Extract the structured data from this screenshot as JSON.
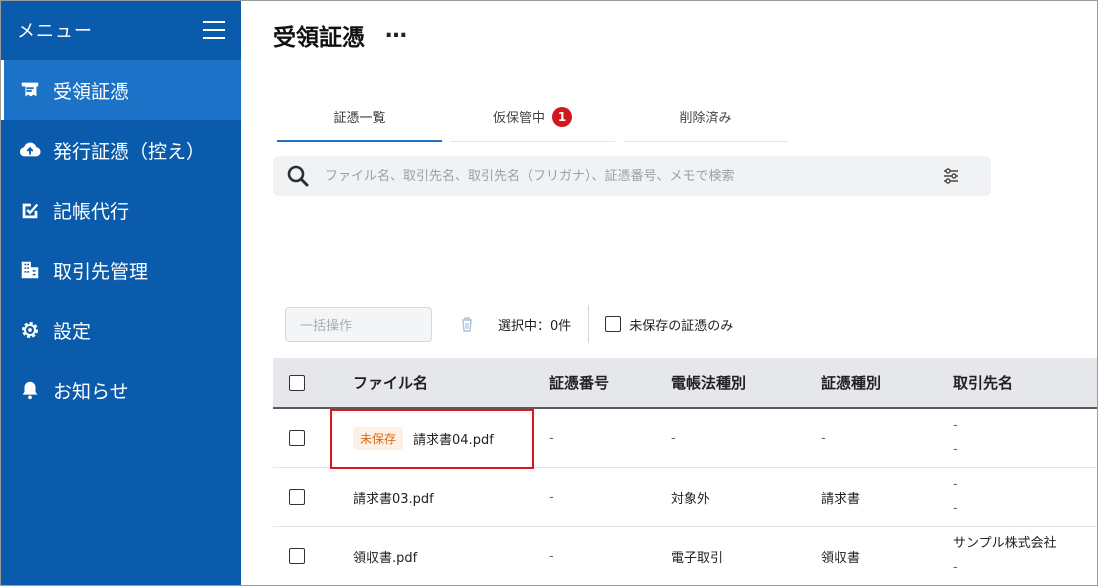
{
  "sidebar": {
    "title": "メニュー",
    "items": [
      {
        "label": "受領証憑",
        "icon": "receipt-icon",
        "active": true
      },
      {
        "label": "発行証憑（控え）",
        "icon": "cloud-upload-icon",
        "active": false
      },
      {
        "label": "記帳代行",
        "icon": "edit-check-icon",
        "active": false
      },
      {
        "label": "取引先管理",
        "icon": "building-icon",
        "active": false
      },
      {
        "label": "設定",
        "icon": "gear-icon",
        "active": false
      },
      {
        "label": "お知らせ",
        "icon": "bell-icon",
        "active": false
      }
    ]
  },
  "header": {
    "title": "受領証憑",
    "more": "…"
  },
  "tabs": [
    {
      "label": "証憑一覧",
      "active": true
    },
    {
      "label": "仮保管中",
      "badge": "1"
    },
    {
      "label": "削除済み"
    }
  ],
  "search": {
    "placeholder": "ファイル名、取引先名、取引先名（フリガナ）、証憑番号、メモで検索"
  },
  "toolbar": {
    "bulk_label": "一括操作",
    "selected": "選択中：0件",
    "unsaved_only": "未保存の証憑のみ"
  },
  "table": {
    "headers": [
      "ファイル名",
      "証憑番号",
      "電帳法種別",
      "証憑種別",
      "取引先名"
    ],
    "rows": [
      {
        "tag": "未保存",
        "file": "請求書04.pdf",
        "number": "-",
        "law_type": "-",
        "doc_type": "-",
        "partner1": "-",
        "partner2": "-"
      },
      {
        "tag": "",
        "file": "請求書03.pdf",
        "number": "-",
        "law_type": "対象外",
        "doc_type": "請求書",
        "partner1": "-",
        "partner2": "-"
      },
      {
        "tag": "",
        "file": "領収書.pdf",
        "number": "-",
        "law_type": "電子取引",
        "doc_type": "領収書",
        "partner1": "サンプル株式会社",
        "partner2": "-"
      }
    ]
  },
  "colors": {
    "sidebar": "#0a5bab",
    "sidebar_active": "#1b72c7",
    "badge": "#d0191c",
    "tag_text": "#d96a12",
    "highlight": "#e0161b"
  }
}
